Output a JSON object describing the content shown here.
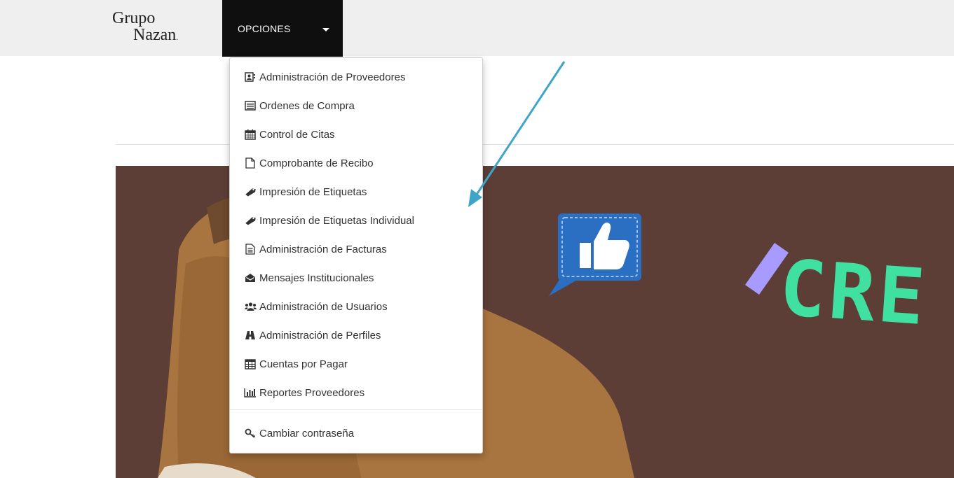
{
  "brand": {
    "line1": "Grupo",
    "line2": "Nazan",
    "line2_suffix": "."
  },
  "nav": {
    "opciones_label": "OPCIONES"
  },
  "menu": {
    "items": [
      {
        "label": "Administración de Proveedores",
        "icon": "id-card-icon"
      },
      {
        "label": "Ordenes de Compra",
        "icon": "list-icon"
      },
      {
        "label": "Control de Citas",
        "icon": "calendar-icon"
      },
      {
        "label": "Comprobante de Recibo",
        "icon": "file-icon"
      },
      {
        "label": "Impresión de Etiquetas",
        "icon": "tag-icon"
      },
      {
        "label": "Impresión de Etiquetas Individual",
        "icon": "tag-icon"
      },
      {
        "label": "Administración de Facturas",
        "icon": "document-icon"
      },
      {
        "label": "Mensajes Institucionales",
        "icon": "envelope-icon"
      },
      {
        "label": "Administración de Usuarios",
        "icon": "users-icon"
      },
      {
        "label": "Administración de Perfiles",
        "icon": "binoculars-icon"
      },
      {
        "label": "Cuentas por Pagar",
        "icon": "calculator-icon"
      },
      {
        "label": "Reportes Proveedores",
        "icon": "bar-chart-icon"
      }
    ],
    "change_password": {
      "label": "Cambiar contraseña",
      "icon": "key-icon"
    }
  },
  "banner": {
    "text": "CRE"
  },
  "colors": {
    "navbar": "#efefef",
    "opciones_bg": "#0f0f0f",
    "banner_bg": "#5c3e36",
    "banner_text": "#3fe0a0",
    "arrow": "#3fa5c8"
  }
}
